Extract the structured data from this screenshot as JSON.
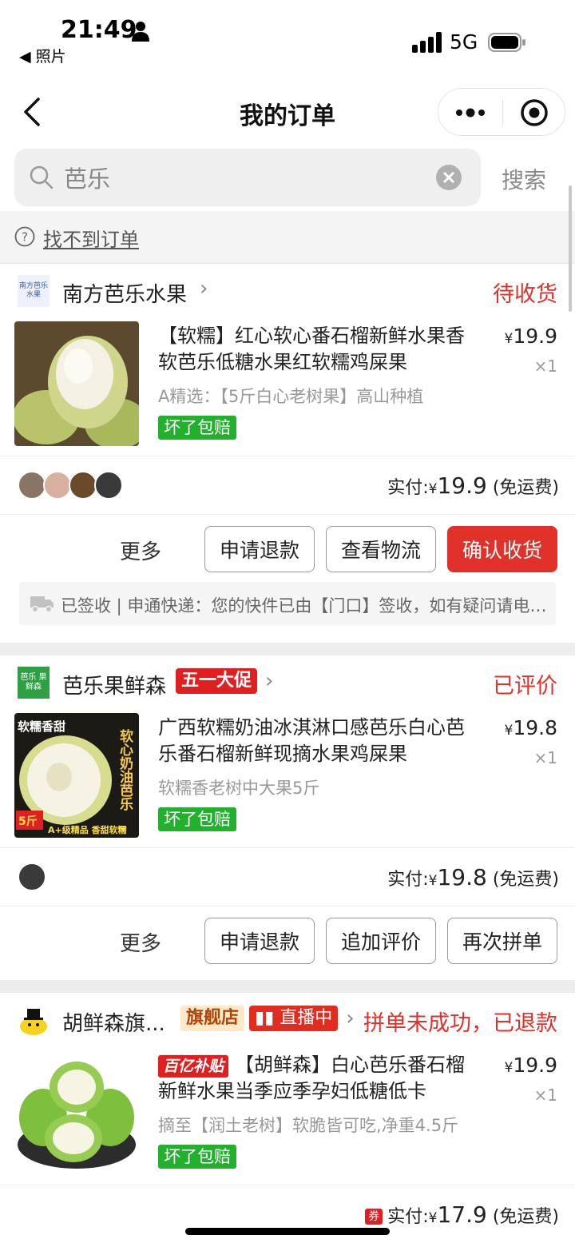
{
  "status_bar": {
    "time": "21:49",
    "back_app": "◀ 照片",
    "network": "5G"
  },
  "nav": {
    "title": "我的订单"
  },
  "search": {
    "value": "芭乐",
    "button": "搜索"
  },
  "not_found": {
    "label": "找不到订单"
  },
  "orders": [
    {
      "shop": "南方芭乐水果",
      "shop_logo_text": "南方芭乐 水果",
      "tags": [],
      "status": "待收货",
      "item": {
        "title": "【软糯】红心软心番石榴新鲜水果香软芭乐低糖水果红软糯鸡屎果",
        "spec": "A精选：【5斤白心老树果】高山种植",
        "badge": "坏了包赔",
        "price": "19.9",
        "qty": "×1",
        "price_tag": ""
      },
      "avatar_count": 4,
      "pay": {
        "label": "实付:",
        "currency": "¥",
        "amount": "19.9",
        "note": "(免运费)",
        "coupon": ""
      },
      "more": "更多",
      "buttons": [
        {
          "label": "申请退款",
          "primary": false
        },
        {
          "label": "查看物流",
          "primary": false
        },
        {
          "label": "确认收货",
          "primary": true
        }
      ],
      "logistics": "已签收 | 申通快递：您的快件已由【门口】签收，如有疑问请电联快递员"
    },
    {
      "shop": "芭乐果鲜森",
      "shop_logo_text": "芭乐 果鲜森",
      "tags": [
        {
          "text": "五一大促",
          "type": "promo"
        }
      ],
      "status": "已评价",
      "item": {
        "title": "广西软糯奶油冰淇淋口感芭乐白心芭乐番石榴新鲜现摘水果鸡屎果",
        "spec": "软糯香老树中大果5斤",
        "badge": "坏了包赔",
        "price": "19.8",
        "qty": "×1",
        "price_tag": "",
        "thumb_text": {
          "top": "软糯香甜",
          "side": "软心奶油芭乐",
          "weight": "5斤",
          "bottom": "A+级精品 香甜软糯"
        }
      },
      "avatar_count": 1,
      "pay": {
        "label": "实付:",
        "currency": "¥",
        "amount": "19.8",
        "note": "(免运费)",
        "coupon": ""
      },
      "more": "更多",
      "buttons": [
        {
          "label": "申请退款",
          "primary": false
        },
        {
          "label": "追加评价",
          "primary": false
        },
        {
          "label": "再次拼单",
          "primary": false
        }
      ],
      "logistics": ""
    },
    {
      "shop": "胡鲜森旗...",
      "shop_logo_text": "",
      "tags": [
        {
          "text": "旗舰店",
          "type": "flag"
        },
        {
          "text": "直播中",
          "type": "live"
        }
      ],
      "status": "拼单未成功，已退款",
      "item": {
        "title": "【胡鲜森】白心芭乐番石榴新鲜水果当季应季孕妇低糖低卡",
        "spec": "摘至【润土老树】软脆皆可吃,净重4.5斤",
        "badge": "坏了包赔",
        "price": "19.9",
        "qty": "×1",
        "price_tag": "百亿补贴"
      },
      "avatar_count": 0,
      "pay": {
        "label": "实付:",
        "currency": "¥",
        "amount": "17.9",
        "note": "(免运费)",
        "coupon": "券"
      },
      "more": "",
      "buttons": [],
      "logistics": ""
    }
  ],
  "colors": {
    "accent_red": "#e0322b",
    "badge_green": "#21b12c",
    "background": "#ededed"
  }
}
